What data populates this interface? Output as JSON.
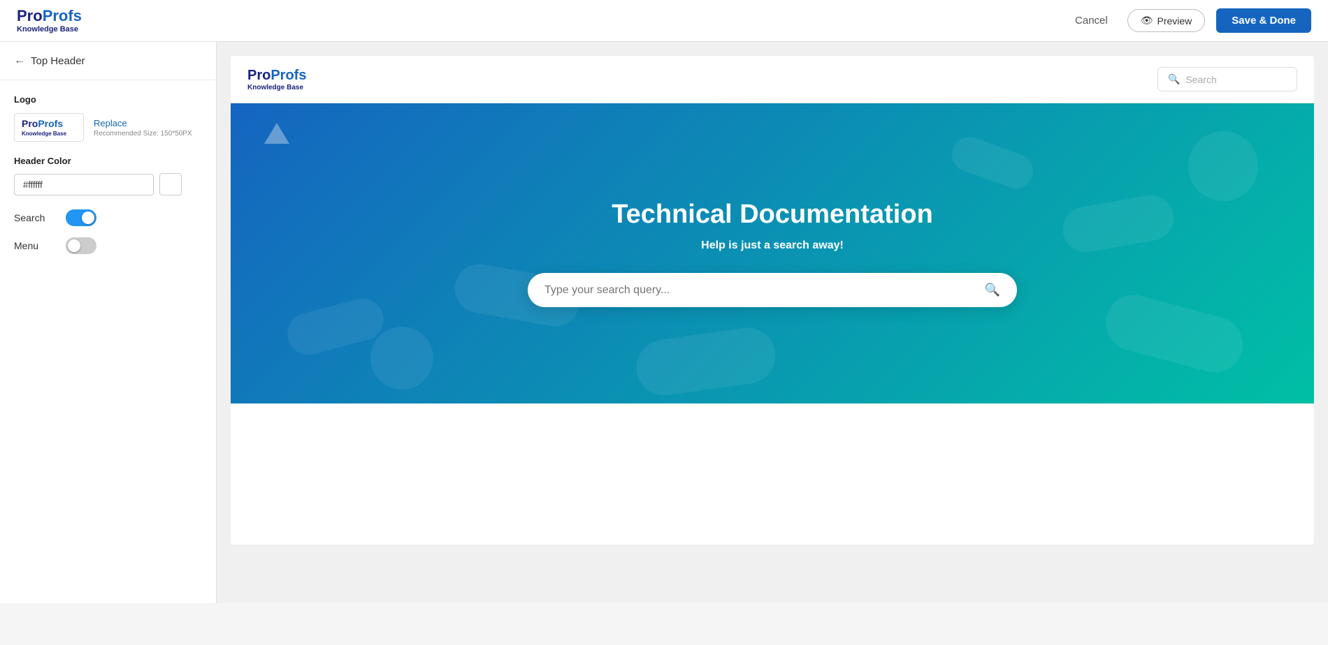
{
  "app": {
    "logo": {
      "pro": "Pro",
      "profs": "Profs",
      "tagline": "Knowledge Base"
    }
  },
  "topnav": {
    "cancel_label": "Cancel",
    "preview_label": "Preview",
    "save_label": "Save & Done"
  },
  "sidebar": {
    "back_label": "Top Header",
    "logo_section_label": "Logo",
    "replace_label": "Replace",
    "recommended_size": "Recommended Size: 150*50PX",
    "header_color_label": "Header Color",
    "header_color_value": "#ffffff",
    "search_label": "Search",
    "menu_label": "Menu",
    "search_toggle": "on",
    "menu_toggle": "off"
  },
  "preview": {
    "header": {
      "search_placeholder": "Search"
    },
    "hero": {
      "title": "Technical Documentation",
      "subtitle": "Help is just a search away!",
      "search_placeholder": "Type your search query..."
    }
  }
}
